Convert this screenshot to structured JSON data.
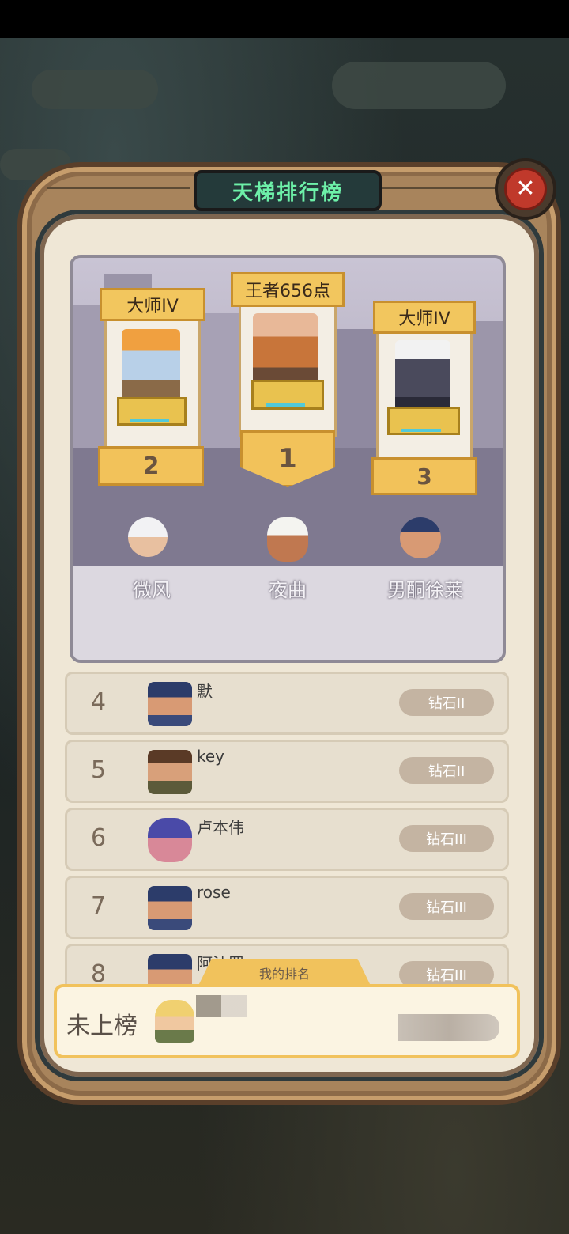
{
  "title": "天梯排行榜",
  "close_icon": "close-icon",
  "top3": [
    {
      "rank": "1",
      "tier": "王者656点",
      "name": "夜曲"
    },
    {
      "rank": "2",
      "tier": "大师IV",
      "name": "微风"
    },
    {
      "rank": "3",
      "tier": "大师IV",
      "name": "男酮徐莱"
    }
  ],
  "rows": [
    {
      "rank": "4",
      "name": "默",
      "tier": "钻石II"
    },
    {
      "rank": "5",
      "name": "key",
      "tier": "钻石II"
    },
    {
      "rank": "6",
      "name": "卢本伟",
      "tier": "钻石III"
    },
    {
      "rank": "7",
      "name": "rose",
      "tier": "钻石III"
    },
    {
      "rank": "8",
      "name": "阿沽罗",
      "tier": "钻石III"
    }
  ],
  "my_rank": {
    "tab_label": "我的排名",
    "status": "未上榜"
  },
  "colors": {
    "title_text": "#6df0a8",
    "gold": "#f2c25a",
    "tier_badge": "#c4b4a2"
  }
}
